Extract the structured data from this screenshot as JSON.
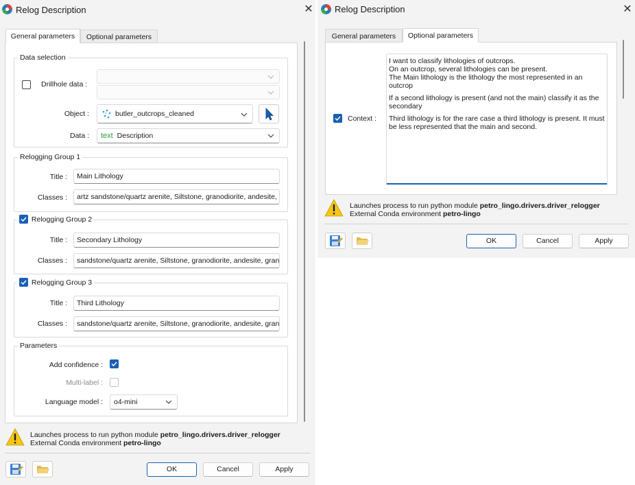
{
  "left_dialog": {
    "title": "Relog Description",
    "tabs": [
      {
        "label": "General parameters",
        "active": true
      },
      {
        "label": "Optional parameters",
        "active": false
      }
    ],
    "data_selection": {
      "group_label": "Data selection",
      "drillhole_label": "Drillhole data :",
      "drillhole_checked": false,
      "object_label": "Object :",
      "object_value": "butler_outcrops_cleaned",
      "object_icon": "point-cloud-icon",
      "data_label": "Data :",
      "data_type_tag": "text",
      "data_value": "Description"
    },
    "relogging_groups": [
      {
        "label": "Relogging Group 1",
        "has_checkbox": false,
        "checked": true,
        "title_label": "Title :",
        "title_value": "Main Lithology",
        "classes_label": "Classes :",
        "classes_value": "artz sandstone/quartz arenite, Siltstone, granodiorite, andesite, grar"
      },
      {
        "label": "Relogging Group 2",
        "has_checkbox": true,
        "checked": true,
        "title_label": "Title :",
        "title_value": "Secondary Lithology",
        "classes_label": "Classes :",
        "classes_value": "sandstone/quartz arenite, Siltstone, granodiorite, andesite, granite"
      },
      {
        "label": "Relogging Group 3",
        "has_checkbox": true,
        "checked": true,
        "title_label": "Title :",
        "title_value": "Third Lithology",
        "classes_label": "Classes :",
        "classes_value": "sandstone/quartz arenite, Siltstone, granodiorite, andesite, granite"
      }
    ],
    "parameters": {
      "group_label": "Parameters",
      "add_confidence_label": "Add confidence :",
      "add_confidence_checked": true,
      "multi_label_label": "Multi-label :",
      "multi_label_checked": false,
      "language_model_label": "Language model :",
      "language_model_value": "o4-mini"
    },
    "info": {
      "line1_prefix": "Launches process to run python module ",
      "module": "petro_lingo.drivers.driver_relogger",
      "line2_prefix": "External Conda environment ",
      "env": "petro-lingo"
    },
    "buttons": {
      "ok": "OK",
      "cancel": "Cancel",
      "apply": "Apply"
    }
  },
  "right_dialog": {
    "title": "Relog Description",
    "tabs": [
      {
        "label": "General parameters",
        "active": false
      },
      {
        "label": "Optional parameters",
        "active": true
      }
    ],
    "context_label": "Context :",
    "context_checked": true,
    "context_text": [
      "I want to classify lithologies of outcrops.",
      "On an outcrop, several lithologies can be present.",
      "The Main lithology is the lithology the most represented in an outcrop",
      "If a second lithology is present (and not the main) classify it as the secondary",
      "Third lithology is for the rare case a third lithology is present. It must be less represented that the main and second."
    ],
    "info": {
      "line1_prefix": "Launches process to run python module ",
      "module": "petro_lingo.drivers.driver_relogger",
      "line2_prefix": "External Conda environment ",
      "env": "petro-lingo"
    },
    "buttons": {
      "ok": "OK",
      "cancel": "Cancel",
      "apply": "Apply"
    }
  },
  "icons": {
    "app": "app-logo-icon",
    "close": "close-icon",
    "warning": "warning-icon",
    "save": "save-icon",
    "open": "open-folder-icon",
    "pick": "pointer-pick-icon",
    "chevron": "chevron-down-icon",
    "check": "check-icon"
  },
  "colors": {
    "accent": "#1a5fb4",
    "warning": "#f5c518",
    "dialog_bg": "#f3f3f3",
    "text_tag": "#2e9b3e"
  }
}
